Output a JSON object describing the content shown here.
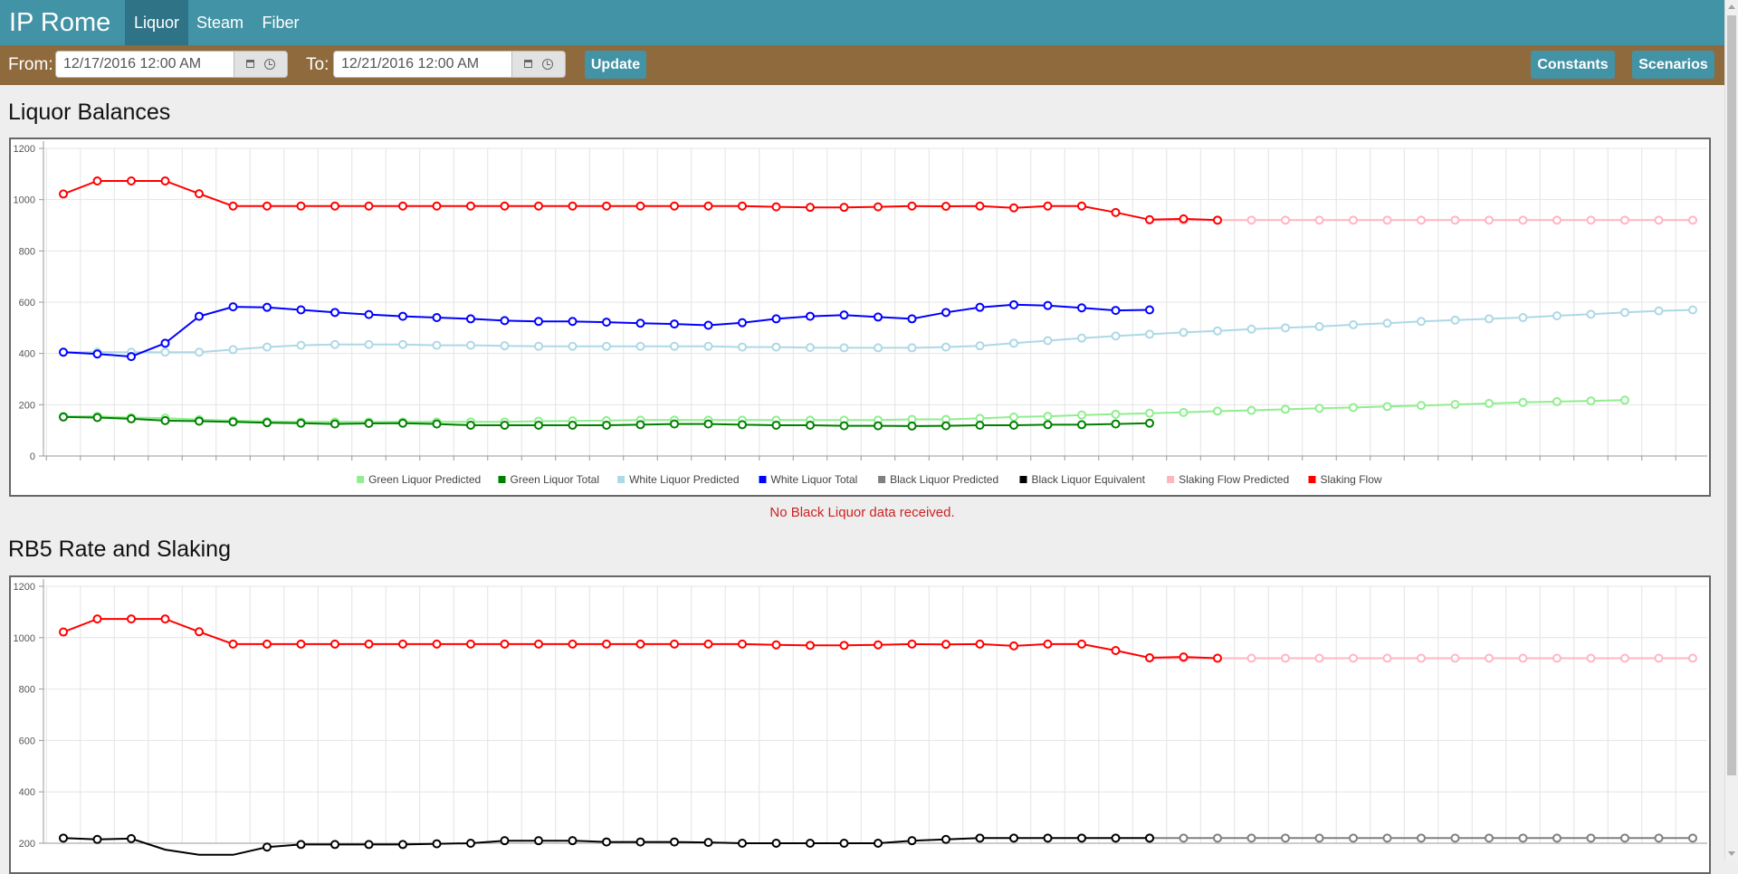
{
  "app": {
    "brand": "IP Rome",
    "tabs": [
      {
        "label": "Liquor",
        "active": true
      },
      {
        "label": "Steam",
        "active": false
      },
      {
        "label": "Fiber",
        "active": false
      }
    ]
  },
  "toolbar": {
    "from_label": "From:",
    "from_value": "12/17/2016 12:00 AM",
    "to_label": "To:",
    "to_value": "12/21/2016 12:00 AM",
    "update_label": "Update",
    "constants_label": "Constants",
    "scenarios_label": "Scenarios"
  },
  "colors": {
    "navbar": "#4393a6",
    "toolbar": "#8f6a3d",
    "button": "#4393a6",
    "notice": "#cc2222"
  },
  "sections": {
    "liquor_title": "Liquor Balances",
    "notice": "No Black Liquor data received.",
    "rb5_title": "RB5 Rate and Slaking"
  },
  "chart_data": [
    {
      "type": "line",
      "title": "Liquor Balances",
      "ylim": [
        0,
        1200
      ],
      "yticks": [
        "0",
        "200",
        "400",
        "600",
        "800",
        "1000",
        "1200"
      ],
      "grid": true,
      "legend_position": "bottom",
      "legend": [
        {
          "label": "Green Liquor Predicted",
          "color": "#90ee90"
        },
        {
          "label": "Green Liquor Total",
          "color": "#008000"
        },
        {
          "label": "White Liquor Predicted",
          "color": "#add8e6"
        },
        {
          "label": "White Liquor Total",
          "color": "#0000ff"
        },
        {
          "label": "Black Liquor Predicted",
          "color": "#808080"
        },
        {
          "label": "Black Liquor Equivalent",
          "color": "#000000"
        },
        {
          "label": "Slaking Flow Predicted",
          "color": "#ffb6c1"
        },
        {
          "label": "Slaking Flow",
          "color": "#ff0000"
        }
      ],
      "x_count": 49,
      "series": [
        {
          "name": "Slaking Flow Predicted",
          "color": "#ffb6c1",
          "start": 32,
          "values": [
            920,
            920,
            920,
            920,
            920,
            920,
            920,
            920,
            920,
            920,
            920,
            920,
            920,
            920,
            920,
            920,
            920
          ]
        },
        {
          "name": "White Liquor Predicted",
          "color": "#add8e6",
          "start": 0,
          "values": [
            405,
            405,
            405,
            405,
            405,
            415,
            425,
            432,
            435,
            435,
            435,
            432,
            432,
            430,
            428,
            428,
            428,
            428,
            428,
            428,
            425,
            425,
            423,
            422,
            422,
            422,
            425,
            430,
            440,
            450,
            460,
            468,
            475,
            482,
            488,
            495,
            500,
            505,
            512,
            518,
            525,
            530,
            535,
            540,
            547,
            553,
            560,
            566,
            570
          ]
        },
        {
          "name": "Green Liquor Predicted",
          "color": "#90ee90",
          "start": 0,
          "values": [
            155,
            155,
            150,
            148,
            142,
            138,
            135,
            133,
            133,
            133,
            133,
            133,
            133,
            133,
            136,
            137,
            138,
            140,
            140,
            140,
            140,
            140,
            140,
            140,
            140,
            143,
            143,
            147,
            152,
            155,
            160,
            163,
            167,
            170,
            175,
            178,
            182,
            186,
            189,
            193,
            197,
            201,
            205,
            209,
            212,
            215,
            218
          ]
        },
        {
          "name": "Slaking Flow",
          "color": "#ff0000",
          "start": 0,
          "values": [
            1022,
            1073,
            1073,
            1073,
            1023,
            975,
            975,
            975,
            975,
            975,
            975,
            975,
            975,
            975,
            975,
            975,
            975,
            975,
            975,
            975,
            975,
            972,
            970,
            970,
            972,
            975,
            974,
            975,
            968,
            975,
            975,
            950,
            922,
            925,
            920
          ]
        },
        {
          "name": "White Liquor Total",
          "color": "#0000ff",
          "start": 0,
          "values": [
            405,
            398,
            388,
            440,
            545,
            582,
            580,
            570,
            560,
            552,
            545,
            540,
            535,
            528,
            525,
            525,
            522,
            518,
            515,
            510,
            520,
            535,
            545,
            550,
            542,
            535,
            560,
            580,
            590,
            587,
            578,
            568,
            570
          ]
        },
        {
          "name": "Green Liquor Total",
          "color": "#008000",
          "start": 0,
          "values": [
            152,
            150,
            145,
            138,
            136,
            133,
            130,
            128,
            125,
            127,
            128,
            125,
            120,
            120,
            120,
            120,
            120,
            122,
            125,
            125,
            122,
            120,
            120,
            118,
            118,
            117,
            118,
            120,
            120,
            122,
            122,
            125,
            128
          ]
        }
      ]
    },
    {
      "type": "line",
      "title": "RB5 Rate and Slaking",
      "ylim": [
        200,
        1200
      ],
      "yticks": [
        "200",
        "400",
        "600",
        "800",
        "1000",
        "1200"
      ],
      "grid": true,
      "x_count": 49,
      "series": [
        {
          "name": "Slaking Flow Predicted",
          "color": "#ffb6c1",
          "start": 32,
          "values": [
            920,
            920,
            920,
            920,
            920,
            920,
            920,
            920,
            920,
            920,
            920,
            920,
            920,
            920,
            920,
            920,
            920
          ]
        },
        {
          "name": "Slaking Flow",
          "color": "#ff0000",
          "start": 0,
          "values": [
            1022,
            1073,
            1073,
            1073,
            1023,
            975,
            975,
            975,
            975,
            975,
            975,
            975,
            975,
            975,
            975,
            975,
            975,
            975,
            975,
            975,
            975,
            972,
            970,
            970,
            972,
            975,
            974,
            975,
            968,
            975,
            975,
            950,
            922,
            925,
            920
          ]
        },
        {
          "name": "Black Liquor Predicted",
          "color": "#808080",
          "start": 32,
          "values": [
            220,
            220,
            220,
            220,
            220,
            220,
            220,
            220,
            220,
            220,
            220,
            220,
            220,
            220,
            220,
            220,
            220
          ]
        },
        {
          "name": "Black Liquor Equivalent",
          "color": "#000000",
          "start": 0,
          "values": [
            220,
            215,
            218,
            175,
            155,
            155,
            185,
            195,
            195,
            195,
            195,
            198,
            200,
            210,
            210,
            210,
            205,
            205,
            205,
            203,
            200,
            200,
            200,
            200,
            200,
            210,
            215,
            220,
            220,
            220,
            220,
            220,
            220
          ]
        }
      ]
    }
  ]
}
